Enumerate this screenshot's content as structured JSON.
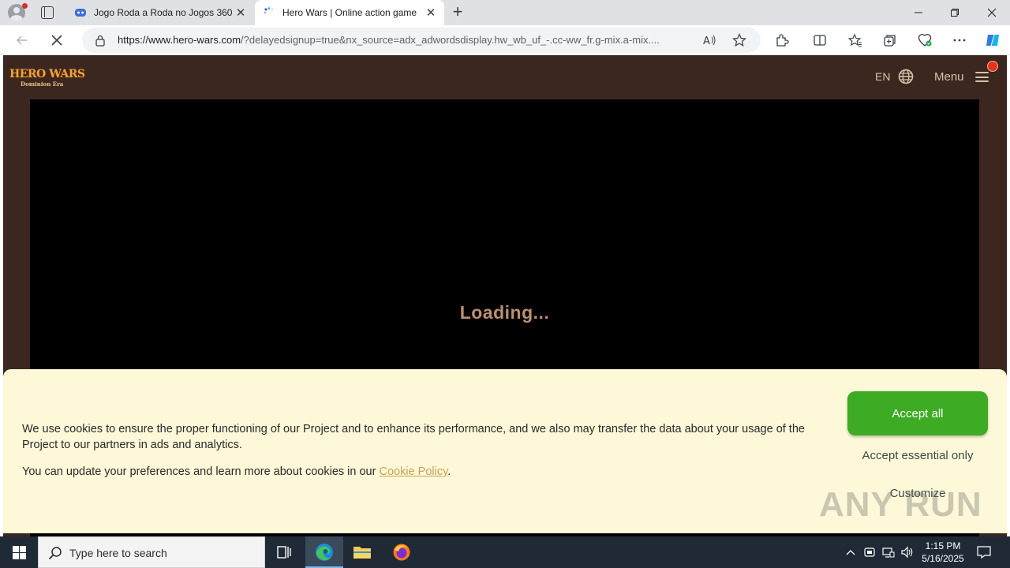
{
  "browser": {
    "tabs": [
      {
        "title": "Jogo Roda a Roda no Jogos 360",
        "active": false,
        "icon": "jogos360-favicon"
      },
      {
        "title": "Hero Wars | Online action game",
        "active": true,
        "icon": "loading-spinner"
      }
    ],
    "url_domain": "https://www.hero-wars.com",
    "url_rest": "/?delayedsignup=true&nx_source=adx_adwordsdisplay.hw_wb_uf_-.cc-ww_fr.g-mix.a-mix...."
  },
  "site": {
    "logo_title": "HERO WARS",
    "logo_subtitle": "Dominion Era",
    "language": "EN",
    "menu_label": "Menu",
    "loading_text": "Loading..."
  },
  "cookie_banner": {
    "text": "We use cookies to ensure the proper functioning of our Project and to enhance its performance, and we also may transfer the data about your usage of the Project to our partners in ads and analytics.",
    "text2_prefix": "You can update your preferences and learn more about cookies in our ",
    "policy_link": "Cookie Policy",
    "text2_suffix": ".",
    "accept_all": "Accept all",
    "accept_essential": "Accept essential only",
    "customize": "Customize",
    "watermark": "ANY RUN"
  },
  "taskbar": {
    "search_placeholder": "Type here to search",
    "time": "1:15 PM",
    "date": "5/16/2025"
  },
  "colors": {
    "page_bg": "#3b2720",
    "accept_green": "#3dab23",
    "banner_bg": "#fdf8d8",
    "loading_text": "#bc8f72",
    "logo_orange": "#f0a338"
  }
}
